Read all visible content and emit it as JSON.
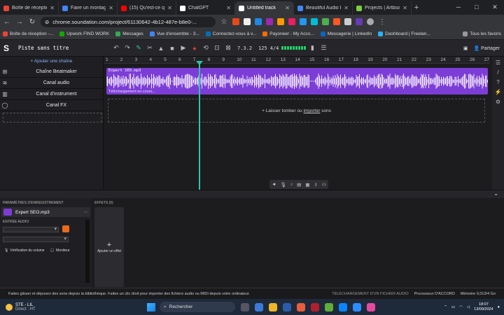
{
  "browser": {
    "tabs": [
      {
        "label": "Boîte de réceptio",
        "color": "#ea4335"
      },
      {
        "label": "Faire un montage",
        "color": "#4285f4"
      },
      {
        "label": "(15) Qu'est-ce qu",
        "color": "#ff0000"
      },
      {
        "label": "ChatGPT",
        "color": "#ffffff"
      },
      {
        "label": "Untitled track",
        "color": "#ffffff",
        "active": true
      },
      {
        "label": "Beautiful Audio E",
        "color": "#4285f4"
      },
      {
        "label": "Projects | Artboar",
        "color": "#7bd03b"
      }
    ],
    "url": "chrome.soundation.com/project/61130642-4b12-487e-b8e0-...",
    "bookmarks": [
      "Boîte de réception -...",
      "Upwork FIND WORK",
      "Messages",
      "Vue d'ensemble - 3...",
      "Connectez-vous à v...",
      "Payoneer - My Acco...",
      "Messagerie | LinkedIn",
      "Dashboard | Freelan..."
    ],
    "all_bookmarks": "Tous les favoris"
  },
  "app": {
    "project_title": "Piste sans titre",
    "tempo_display": "7.3.2",
    "bpm": "125",
    "time_signature": "4/4",
    "share_label": "Partager",
    "add_chain": "+ Ajouter une chaîne",
    "tracks": [
      {
        "name": "Chaîne Beatmaker",
        "icon": "⊞"
      },
      {
        "name": "Canal audio",
        "icon": "≋"
      },
      {
        "name": "Canal d'instrument",
        "icon": "▥"
      },
      {
        "name": "Canal FX",
        "icon": "◯"
      }
    ],
    "ruler": [
      "1",
      "2",
      "3",
      "4",
      "5",
      "6",
      "7",
      "8",
      "9",
      "10",
      "11",
      "12",
      "13",
      "14",
      "15",
      "16",
      "17",
      "18",
      "19",
      "20",
      "21",
      "22",
      "23",
      "24",
      "25",
      "26",
      "27"
    ],
    "clip": {
      "name": "Expert SEO.mp3",
      "status": "Téléchargement en cours...",
      "color": "#7c3dd6"
    },
    "drop_text_1": "+ Laisser tomber ou ",
    "drop_link": "importer",
    "drop_text_2": " sons",
    "rec_params_title": "PARAMÈTRES D'ENREGISTREMENT",
    "track_name": "Expert SEO.mp3",
    "audio_input": "ENTRÉE AUDIO",
    "volume_check": "Vérification du volume",
    "monitor": "Moniteur",
    "effects_title": "EFFETS (0)",
    "add_effect": "Ajouter un effet",
    "status_hint": "Faites glisser et déposez des sons depuis la bibliothèque. Faites un clic droit pour importer des fichiers audio ou MIDI depuis votre ordinateur.",
    "upload_status": "TÉLÉCHARGEMENT D'UN FICHIER AUDIO",
    "processor": "Processeur D'ACCORD",
    "memory_label": "Mémoire",
    "memory_value": "0,013",
    "memory_unit": "/4 Go"
  },
  "taskbar": {
    "weather_title": "STE - LIL",
    "weather_sub": "Direct : HT",
    "search_placeholder": "Rechercher",
    "time": "18:07",
    "date": "13/09/2024"
  }
}
